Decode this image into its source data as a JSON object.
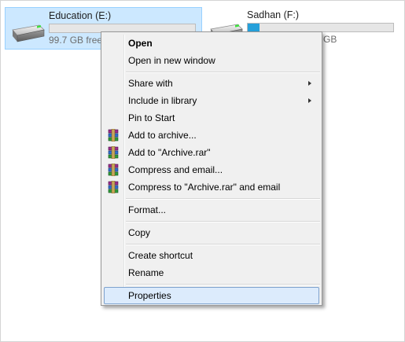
{
  "drives": [
    {
      "name": "Education (E:)",
      "free": "99.7 GB free",
      "used_fraction": 0.0,
      "selected": true
    },
    {
      "name": "Sadhan (F:)",
      "free": "GB",
      "used_fraction": 0.08,
      "selected": false
    }
  ],
  "menu": {
    "open": "Open",
    "open_new_window": "Open in new window",
    "share_with": "Share with",
    "include_in_library": "Include in library",
    "pin_to_start": "Pin to Start",
    "add_to_archive": "Add to archive...",
    "add_to_archive_rar": "Add to \"Archive.rar\"",
    "compress_email": "Compress and email...",
    "compress_rar_email": "Compress to \"Archive.rar\" and email",
    "format": "Format...",
    "copy": "Copy",
    "create_shortcut": "Create shortcut",
    "rename": "Rename",
    "properties": "Properties"
  },
  "icons": {
    "drive": "hard-drive-icon",
    "winrar": "winrar-archive-icon",
    "submenu": "chevron-right-icon"
  },
  "colors": {
    "selection_fill": "#cce8ff",
    "selection_border": "#99d1ff",
    "menu_bg": "#f0f0f0",
    "highlight_fill": "#dcebfc",
    "highlight_border": "#7da2ce",
    "capacity_fill": "#26a0da"
  }
}
